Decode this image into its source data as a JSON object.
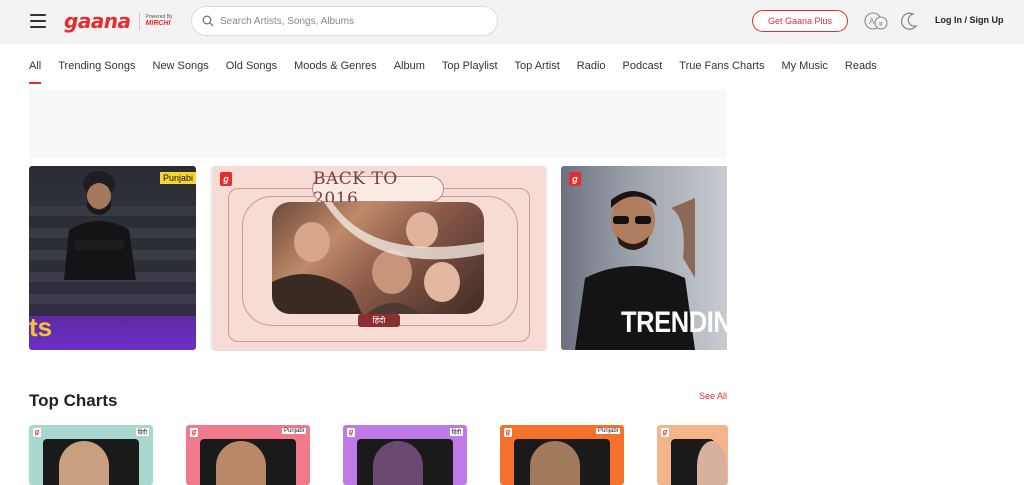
{
  "header": {
    "logo_text": "gaana",
    "powered_by": "Powered By",
    "powered_brand": "MIRCHI",
    "search_placeholder": "Search Artists, Songs, Albums",
    "gaana_plus_label": "Get Gaana Plus",
    "login_label": "Log In / Sign Up"
  },
  "nav": {
    "items": [
      {
        "label": "All",
        "active": true
      },
      {
        "label": "Trending Songs"
      },
      {
        "label": "New Songs"
      },
      {
        "label": "Old Songs"
      },
      {
        "label": "Moods & Genres"
      },
      {
        "label": "Album"
      },
      {
        "label": "Top Playlist"
      },
      {
        "label": "Top Artist"
      },
      {
        "label": "Radio"
      },
      {
        "label": "Podcast"
      },
      {
        "label": "True Fans Charts"
      },
      {
        "label": "My Music"
      },
      {
        "label": "Reads"
      }
    ]
  },
  "carousel": {
    "cards": [
      {
        "badge": "g",
        "lang": "Punjabi",
        "text": "ts"
      },
      {
        "badge": "g",
        "title": "BACK TO 2016",
        "lang": "हिंदी"
      },
      {
        "badge": "g",
        "text": "TRENDING"
      }
    ]
  },
  "top_charts": {
    "title": "Top Charts",
    "see_all": "See All",
    "cards": [
      {
        "badge": "g",
        "lang": "हिंदी",
        "color": "#a8d8d0"
      },
      {
        "badge": "g",
        "lang": "Punjabi",
        "color": "#f07a8c"
      },
      {
        "badge": "g",
        "lang": "हिंदी",
        "color": "#c07ae8"
      },
      {
        "badge": "g",
        "lang": "Punjabi",
        "color": "#f4722b"
      },
      {
        "badge": "g",
        "lang": "",
        "color": "#f4b48c"
      }
    ]
  },
  "colors": {
    "brand": "#e72c30",
    "header_bg": "#f3f3f3"
  }
}
